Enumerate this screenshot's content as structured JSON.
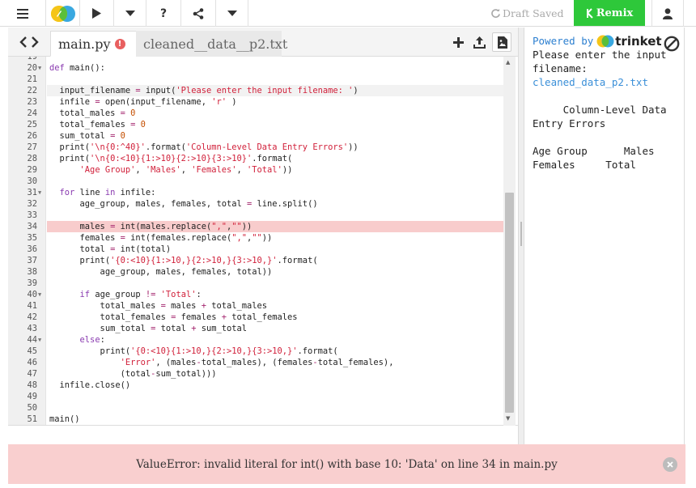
{
  "toolbar": {
    "menu_icon": "hamburger-icon",
    "logo_icon": "trinket-logo-icon",
    "run_icon": "play-icon",
    "run_options_icon": "chevron-down-icon",
    "help_label": "?",
    "share_icon": "share-icon",
    "share_options_icon": "chevron-down-icon",
    "draft_status": "Draft Saved",
    "remix_label": "Remix",
    "user_icon": "user-icon"
  },
  "tabs": [
    {
      "label": "main.py",
      "active": true,
      "has_error": true,
      "error_badge": "!"
    },
    {
      "label": "cleaned__data__p2.txt",
      "active": false
    }
  ],
  "editor": {
    "active_line": 22,
    "error_line": 34,
    "lines": [
      {
        "n": "19",
        "fold": false,
        "html": ""
      },
      {
        "n": "20",
        "fold": true,
        "html": "<span class=\"kw\">def</span> main():"
      },
      {
        "n": "21",
        "fold": false,
        "html": ""
      },
      {
        "n": "22",
        "fold": false,
        "html": "  input_filename <span class=\"op\">=</span> input(<span class=\"st\">'Please enter the input filename: '</span>)"
      },
      {
        "n": "23",
        "fold": false,
        "html": "  infile <span class=\"op\">=</span> open(input_filename, <span class=\"st\">'r'</span> )"
      },
      {
        "n": "24",
        "fold": false,
        "html": "  total_males <span class=\"op\">=</span> <span class=\"nm\">0</span>"
      },
      {
        "n": "25",
        "fold": false,
        "html": "  total_females <span class=\"op\">=</span> <span class=\"nm\">0</span>"
      },
      {
        "n": "26",
        "fold": false,
        "html": "  sum_total <span class=\"op\">=</span> <span class=\"nm\">0</span>"
      },
      {
        "n": "27",
        "fold": false,
        "html": "  print(<span class=\"st\">'\\n{0:^40}'</span>.format(<span class=\"st\">'Column-Level Data Entry Errors'</span>))"
      },
      {
        "n": "28",
        "fold": false,
        "html": "  print(<span class=\"st\">'\\n{0:&lt;10}{1:&gt;10}{2:&gt;10}{3:&gt;10}'</span>.format("
      },
      {
        "n": "29",
        "fold": false,
        "html": "      <span class=\"st\">'Age Group'</span>, <span class=\"st\">'Males'</span>, <span class=\"st\">'Females'</span>, <span class=\"st\">'Total'</span>))"
      },
      {
        "n": "30",
        "fold": false,
        "html": ""
      },
      {
        "n": "31",
        "fold": true,
        "html": "  <span class=\"kw\">for</span> line <span class=\"kw\">in</span> infile:"
      },
      {
        "n": "32",
        "fold": false,
        "html": "      age_group, males, females, total <span class=\"op\">=</span> line.split()"
      },
      {
        "n": "33",
        "fold": false,
        "html": ""
      },
      {
        "n": "34",
        "fold": false,
        "html": "      males <span class=\"op\">=</span> int(males.replace(<span class=\"st\">\",\"</span>,<span class=\"st\">\"\"</span>))"
      },
      {
        "n": "35",
        "fold": false,
        "html": "      females <span class=\"op\">=</span> int(females.replace(<span class=\"st\">\",\"</span>,<span class=\"st\">\"\"</span>))"
      },
      {
        "n": "36",
        "fold": false,
        "html": "      total <span class=\"op\">=</span> int(total)"
      },
      {
        "n": "37",
        "fold": false,
        "html": "      print(<span class=\"st\">'{0:&lt;10}{1:&gt;10,}{2:&gt;10,}{3:&gt;10,}'</span>.format("
      },
      {
        "n": "38",
        "fold": false,
        "html": "          age_group, males, females, total))"
      },
      {
        "n": "39",
        "fold": false,
        "html": ""
      },
      {
        "n": "40",
        "fold": true,
        "html": "      <span class=\"kw\">if</span> age_group <span class=\"op\">!=</span> <span class=\"st\">'Total'</span>:"
      },
      {
        "n": "41",
        "fold": false,
        "html": "          total_males <span class=\"op\">=</span> males <span class=\"op\">+</span> total_males"
      },
      {
        "n": "42",
        "fold": false,
        "html": "          total_females <span class=\"op\">=</span> females <span class=\"op\">+</span> total_females"
      },
      {
        "n": "43",
        "fold": false,
        "html": "          sum_total <span class=\"op\">=</span> total <span class=\"op\">+</span> sum_total"
      },
      {
        "n": "44",
        "fold": true,
        "html": "      <span class=\"kw\">else</span>:"
      },
      {
        "n": "45",
        "fold": false,
        "html": "          print(<span class=\"st\">'{0:&lt;10}{1:&gt;10,}{2:&gt;10,}{3:&gt;10,}'</span>.format("
      },
      {
        "n": "46",
        "fold": false,
        "html": "              <span class=\"st\">'Error'</span>, (males<span class=\"op\">-</span>total_males), (females<span class=\"op\">-</span>total_females),"
      },
      {
        "n": "47",
        "fold": false,
        "html": "              (total<span class=\"op\">-</span>sum_total)))"
      },
      {
        "n": "48",
        "fold": false,
        "html": "  infile.close()"
      },
      {
        "n": "49",
        "fold": false,
        "html": ""
      },
      {
        "n": "50",
        "fold": false,
        "html": ""
      },
      {
        "n": "51",
        "fold": false,
        "html": "main()"
      }
    ]
  },
  "output": {
    "powered_by": "Powered by",
    "brand": "trinket",
    "lines": [
      {
        "text": "Please enter the input",
        "input": false
      },
      {
        "text": "filename:",
        "input": false
      },
      {
        "text": "cleaned_data_p2.txt",
        "input": true
      },
      {
        "text": "",
        "input": false
      },
      {
        "text": "     Column-Level Data",
        "input": false
      },
      {
        "text": "Entry Errors",
        "input": false
      },
      {
        "text": "",
        "input": false
      },
      {
        "text": "Age Group      Males",
        "input": false
      },
      {
        "text": "Females     Total",
        "input": false
      }
    ]
  },
  "error": {
    "message": "ValueError: invalid literal for int() with base 10: 'Data' on line 34 in main.py",
    "close_icon": "close-icon"
  },
  "colors": {
    "remix": "#2ec83a",
    "error_bg": "#f9cfcf",
    "error_line": "#f8cccc",
    "link": "#2c7fd0"
  }
}
